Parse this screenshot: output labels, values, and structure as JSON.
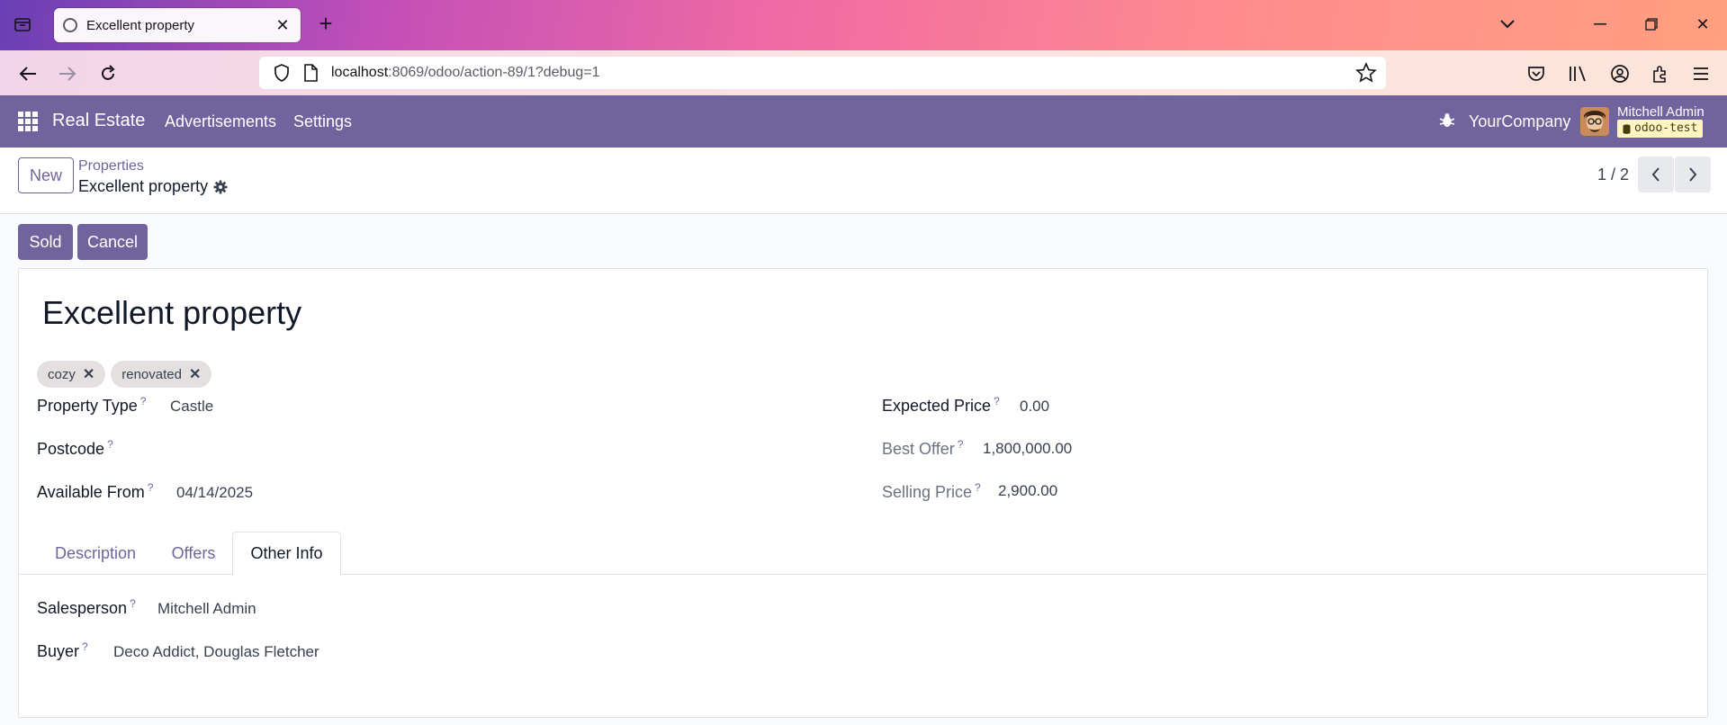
{
  "browser": {
    "tab_title": "Excellent property",
    "url_host": "localhost",
    "url_path": ":8069/odoo/action-89/1?debug=1"
  },
  "topnav": {
    "app_name": "Real Estate",
    "menus": [
      "Advertisements",
      "Settings"
    ],
    "company": "YourCompany",
    "user_name": "Mitchell Admin",
    "database": "odoo-test"
  },
  "control_panel": {
    "new_label": "New",
    "breadcrumb_parent": "Properties",
    "breadcrumb_current": "Excellent property",
    "pager": "1 / 2"
  },
  "statusbar": {
    "sold_label": "Sold",
    "cancel_label": "Cancel"
  },
  "form": {
    "title": "Excellent property",
    "tags": [
      "cozy",
      "renovated"
    ],
    "left_fields": [
      {
        "label": "Property Type",
        "value": "Castle"
      },
      {
        "label": "Postcode",
        "value": ""
      },
      {
        "label": "Available From",
        "value": "04/14/2025"
      }
    ],
    "right_fields": [
      {
        "label": "Expected Price",
        "value": "0.00"
      },
      {
        "label": "Best Offer",
        "value": "1,800,000.00"
      },
      {
        "label": "Selling Price",
        "value": "2,900.00"
      }
    ],
    "help_mark": "?",
    "tabs": [
      "Description",
      "Offers",
      "Other Info"
    ],
    "active_tab": "Other Info",
    "other_info": [
      {
        "label": "Salesperson",
        "value": "Mitchell Admin"
      },
      {
        "label": "Buyer",
        "value": "Deco Addict, Douglas Fletcher"
      }
    ]
  }
}
